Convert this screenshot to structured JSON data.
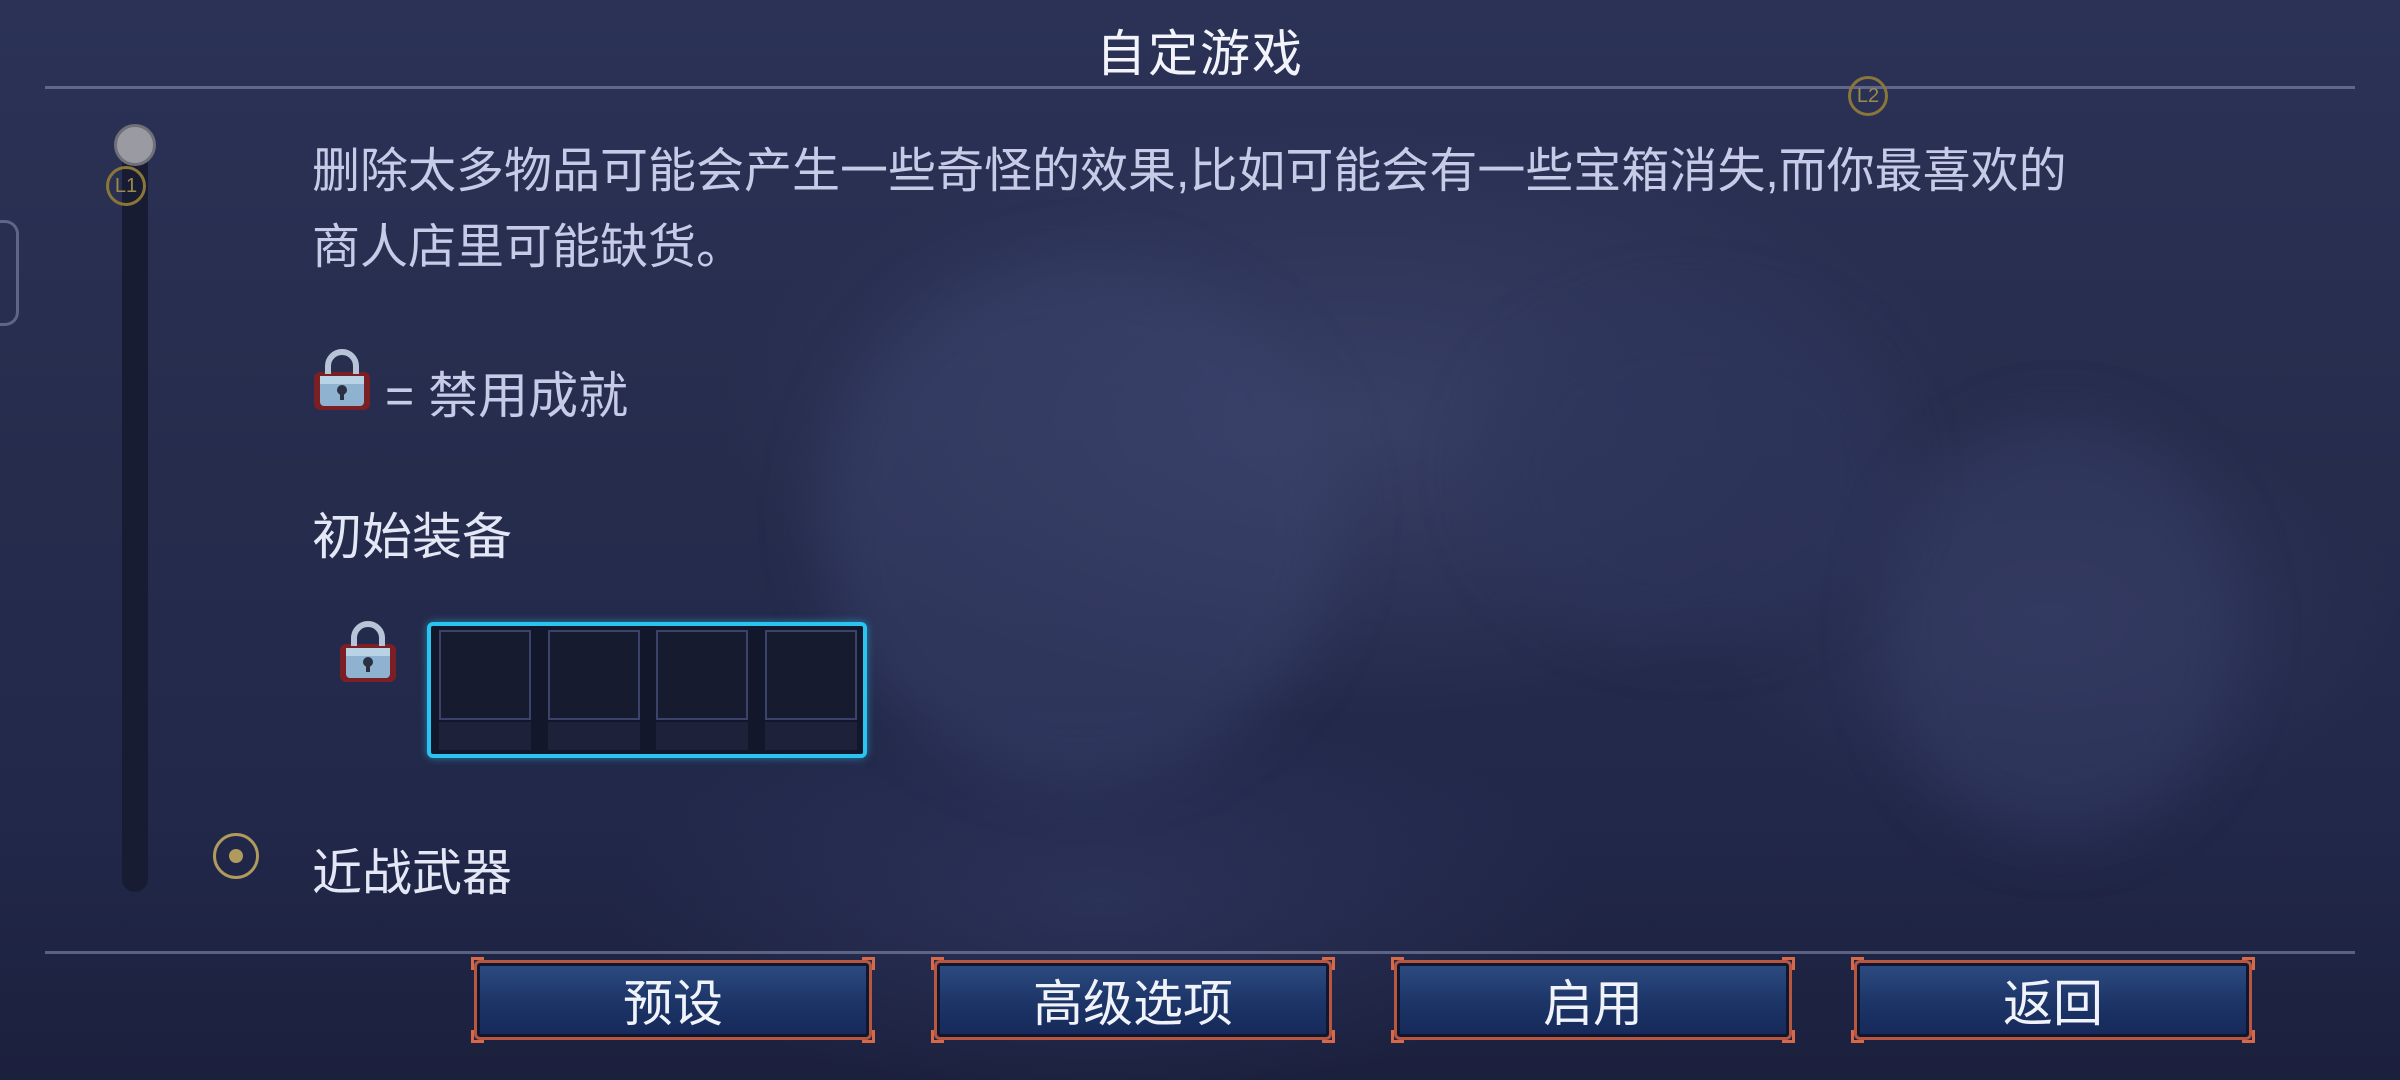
{
  "header": {
    "title": "自定游戏"
  },
  "hints": {
    "left_shoulder": "L1",
    "right_shoulder": "L2"
  },
  "description": "删除太多物品可能会产生一些奇怪的效果,比如可能会有一些宝箱消失,而你最喜欢的商人店里可能缺货。",
  "legend": {
    "icon": "lock-icon",
    "text": "= 禁用成就"
  },
  "sections": {
    "starting_gear": {
      "label": "初始装备",
      "slot_count": 4,
      "locked": true
    },
    "melee": {
      "label": "近战武器",
      "selected": true
    }
  },
  "footer_buttons": [
    "预设",
    "高级选项",
    "启用",
    "返回"
  ],
  "colors": {
    "slot_highlight": "#29c4f0",
    "button_border": "#b8563f",
    "button_fill": "#1c3466",
    "hint_gold": "#9c8a4c"
  }
}
